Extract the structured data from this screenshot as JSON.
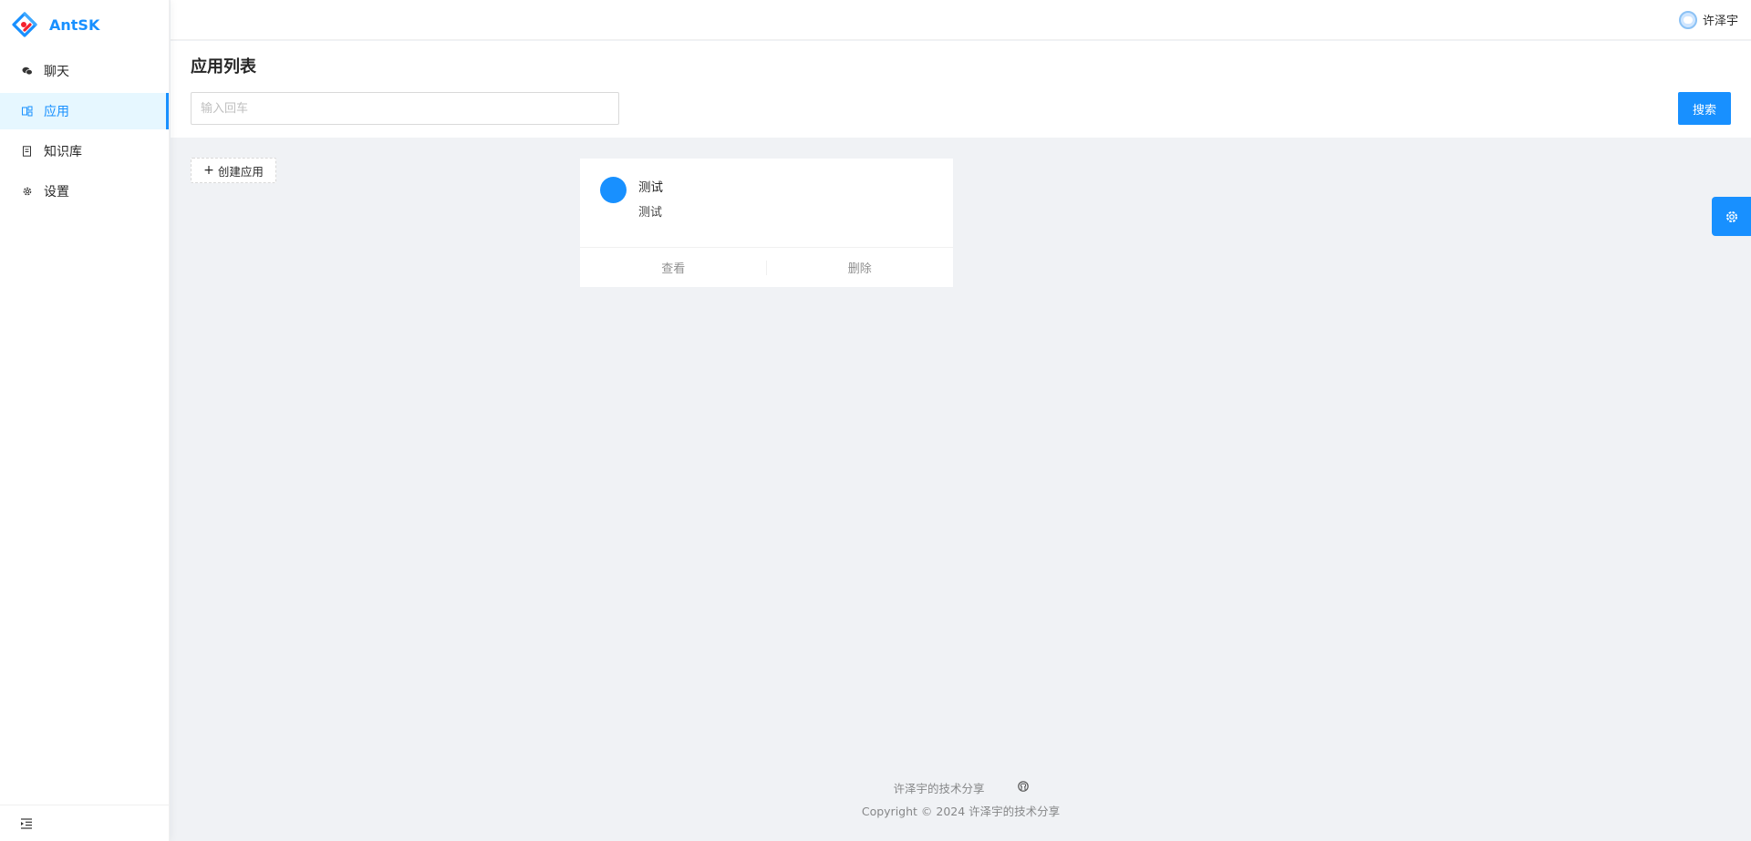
{
  "app": {
    "name": "AntSK"
  },
  "sidebar": {
    "items": [
      {
        "label": "聊天",
        "icon": "wechat-icon",
        "active": false
      },
      {
        "label": "应用",
        "icon": "app-icon",
        "active": true
      },
      {
        "label": "知识库",
        "icon": "book-icon",
        "active": false
      },
      {
        "label": "设置",
        "icon": "gear-icon",
        "active": false
      }
    ],
    "collapse_icon": "menu-fold-icon"
  },
  "header": {
    "user_name": "许泽宇"
  },
  "page": {
    "title": "应用列表",
    "search": {
      "placeholder": "输入回车",
      "value": "",
      "button_label": "搜索"
    },
    "create_label": "创建应用"
  },
  "cards": [
    {
      "title": "测试",
      "description": "测试",
      "actions": [
        "查看",
        "删除"
      ]
    }
  ],
  "footer": {
    "link_text": "许泽宇的技术分享",
    "copyright": "Copyright © 2024 许泽宇的技术分享"
  },
  "colors": {
    "primary": "#1890ff",
    "background": "#f0f2f5",
    "active_bg": "#e6f7ff"
  }
}
